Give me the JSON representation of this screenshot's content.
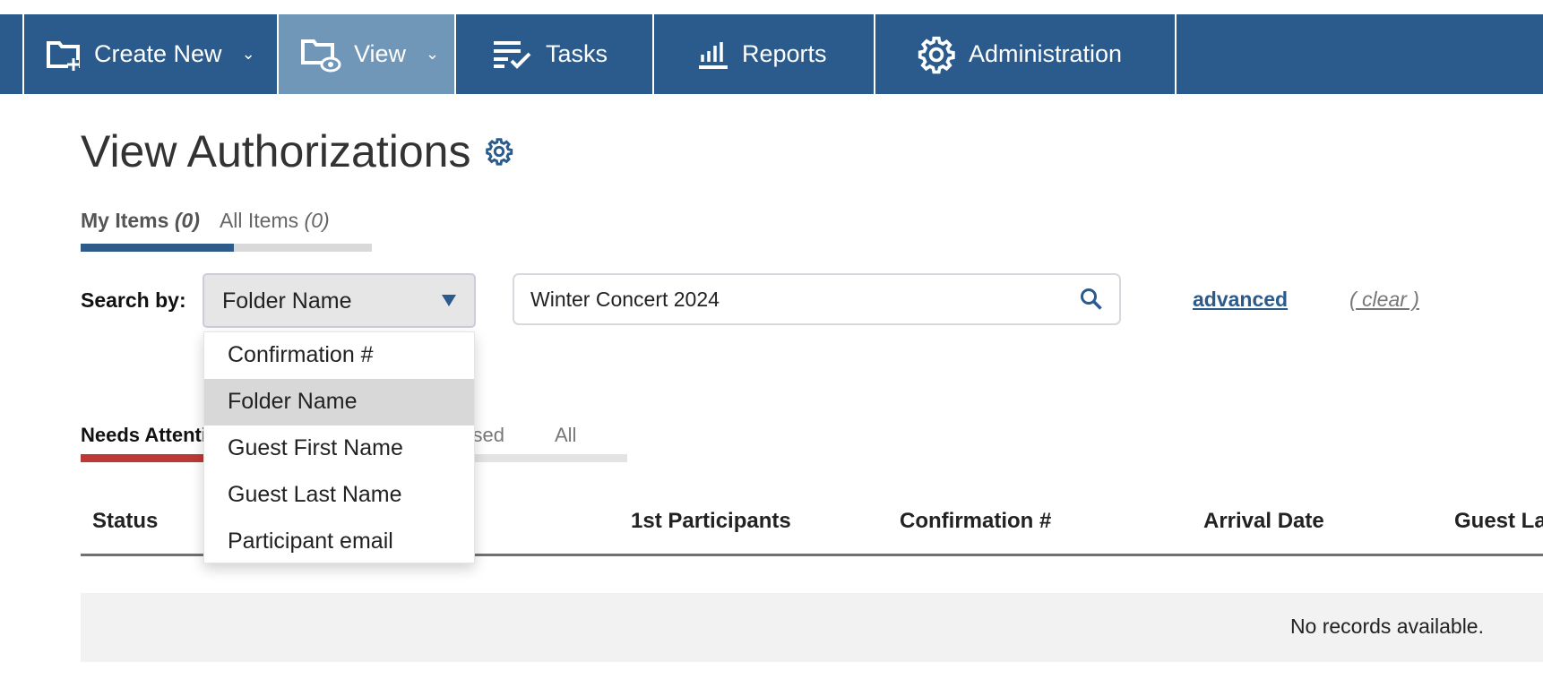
{
  "nav": {
    "items": [
      {
        "label": "Create New",
        "icon": "folder-plus-icon",
        "dropdown": true
      },
      {
        "label": "View",
        "icon": "folder-eye-icon",
        "dropdown": true,
        "active": true
      },
      {
        "label": "Tasks",
        "icon": "tasks-check-icon"
      },
      {
        "label": "Reports",
        "icon": "bar-chart-icon"
      },
      {
        "label": "Administration",
        "icon": "gear-icon"
      }
    ],
    "chevron": "⌄"
  },
  "page": {
    "title": "View Authorizations",
    "settings_icon": "gear-icon"
  },
  "tabs": {
    "my_label": "My Items",
    "my_count": "(0)",
    "all_label": "All Items",
    "all_count": "(0)"
  },
  "search": {
    "label": "Search by:",
    "selected": "Folder Name",
    "value": "Winter Concert 2024",
    "advanced": "advanced",
    "clear": "( clear )",
    "options": [
      "Confirmation #",
      "Folder Name",
      "Guest First Name",
      "Guest Last Name",
      "Participant email"
    ]
  },
  "subtabs": [
    "Needs Attention",
    "Closed",
    "All"
  ],
  "table": {
    "columns": [
      "Status",
      "1st Participants",
      "Confirmation #",
      "Arrival Date",
      "Guest La"
    ],
    "empty": "No records available."
  },
  "colors": {
    "nav": "#2a5b8c",
    "nav_active": "#7096b8",
    "accent": "#2f5b8b",
    "alert": "#bb3a35"
  }
}
